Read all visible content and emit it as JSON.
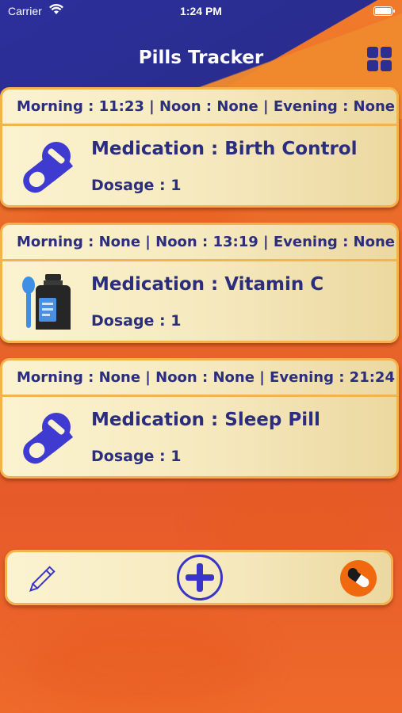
{
  "status_bar": {
    "carrier": "Carrier",
    "time": "1:24 PM"
  },
  "header": {
    "title": "Pills Tracker"
  },
  "medications": [
    {
      "schedule": "Morning : 11:23 | Noon : None | Evening : None",
      "name": "Medication : Birth Control",
      "dosage": "Dosage : 1",
      "icon": "pill-capsule-icon"
    },
    {
      "schedule": "Morning : None | Noon : 13:19 | Evening : None",
      "name": "Medication : Vitamin C",
      "dosage": "Dosage : 1",
      "icon": "syrup-bottle-icon"
    },
    {
      "schedule": "Morning : None | Noon : None | Evening : 21:24",
      "name": "Medication : Sleep Pill",
      "dosage": "Dosage : 1",
      "icon": "pill-capsule-icon"
    }
  ],
  "toolbar": {
    "edit_icon": "pencil-icon",
    "add_icon": "plus-circle-icon",
    "pills_icon": "pills-icon"
  },
  "colors": {
    "accent_blue": "#2b2d7e",
    "header_blue": "#2c2f9c",
    "orange": "#f0690e",
    "card_border": "#f3b24b"
  }
}
